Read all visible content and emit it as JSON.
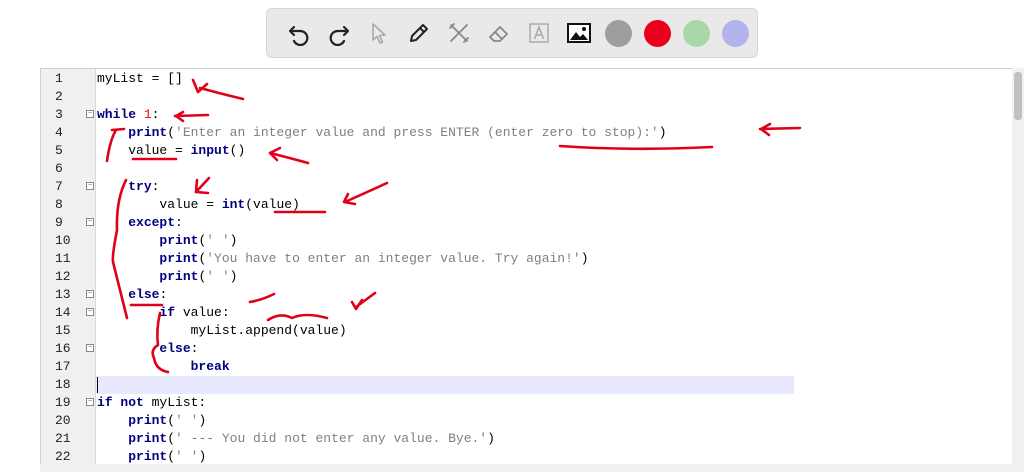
{
  "toolbar": {
    "tools": [
      "undo-icon",
      "redo-icon",
      "pointer-icon",
      "pen-icon",
      "tools-icon",
      "eraser-icon",
      "text-icon",
      "image-icon"
    ],
    "colors": [
      "#9e9e9e",
      "#e8001c",
      "#a8d8a8",
      "#b4b4ec"
    ]
  },
  "editor": {
    "highlight_line": 18,
    "lines": [
      {
        "n": "1",
        "code": "myList = []"
      },
      {
        "n": "2",
        "code": ""
      },
      {
        "n": "3",
        "code": "while 1:"
      },
      {
        "n": "4",
        "code": "    print('Enter an integer value and press ENTER (enter zero to stop):')"
      },
      {
        "n": "5",
        "code": "    value = input()"
      },
      {
        "n": "6",
        "code": ""
      },
      {
        "n": "7",
        "code": "    try:"
      },
      {
        "n": "8",
        "code": "        value = int(value)"
      },
      {
        "n": "9",
        "code": "    except:"
      },
      {
        "n": "10",
        "code": "        print(' ')"
      },
      {
        "n": "11",
        "code": "        print('You have to enter an integer value. Try again!')"
      },
      {
        "n": "12",
        "code": "        print(' ')"
      },
      {
        "n": "13",
        "code": "    else:"
      },
      {
        "n": "14",
        "code": "        if value:"
      },
      {
        "n": "15",
        "code": "            myList.append(value)"
      },
      {
        "n": "16",
        "code": "        else:"
      },
      {
        "n": "17",
        "code": "            break"
      },
      {
        "n": "18",
        "code": ""
      },
      {
        "n": "19",
        "code": "if not myList:"
      },
      {
        "n": "20",
        "code": "    print(' ')"
      },
      {
        "n": "21",
        "code": "    print(' --- You did not enter any value. Bye.')"
      },
      {
        "n": "22",
        "code": "    print(' ')"
      }
    ]
  }
}
